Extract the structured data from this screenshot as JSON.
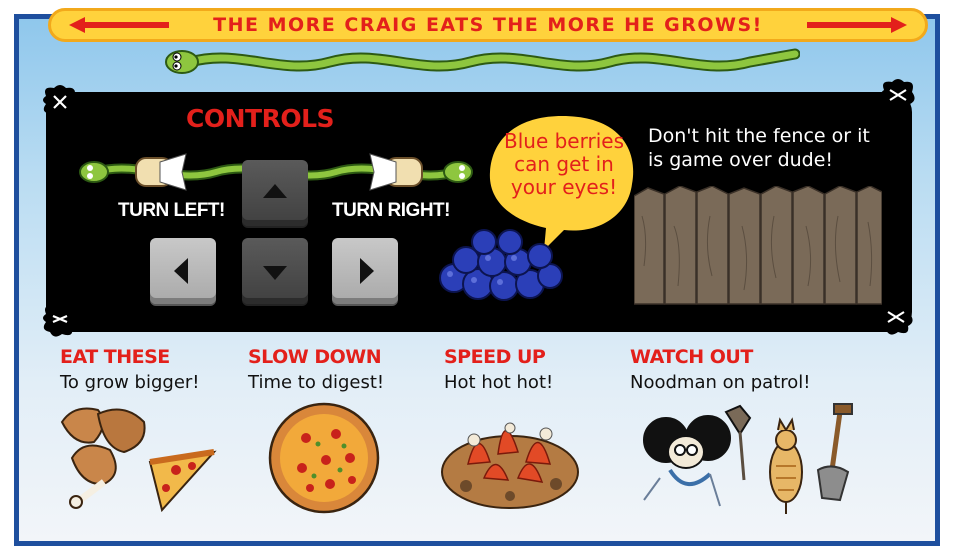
{
  "banner": {
    "title": "The More Craig Eats The More He Grows!"
  },
  "controls": {
    "title": "CONTROLS",
    "turn_left": "TURN LEFT!",
    "turn_right": "TURN RIGHT!"
  },
  "tips": {
    "blueberries": "Blue berries can get in your eyes!",
    "fence": "Don't hit the fence or it is game over dude!"
  },
  "sections": [
    {
      "head": "EAT THESE",
      "sub": "To grow bigger!"
    },
    {
      "head": "SLOW DOWN",
      "sub": "Time to digest!"
    },
    {
      "head": "SPEED UP",
      "sub": "Hot hot hot!"
    },
    {
      "head": "WATCH OUT",
      "sub": "Noodman on patrol!"
    }
  ],
  "colors": {
    "accent": "#e3201b",
    "banner": "#ffd23c",
    "frame": "#1e4f9e",
    "snake": "#8ec63f"
  },
  "icons": [
    "left-arrow-icon",
    "right-arrow-icon",
    "snake-icon",
    "up-key-icon",
    "down-key-icon",
    "left-key-icon",
    "right-key-icon",
    "blueberries-icon",
    "fence-icon",
    "close-icon"
  ]
}
